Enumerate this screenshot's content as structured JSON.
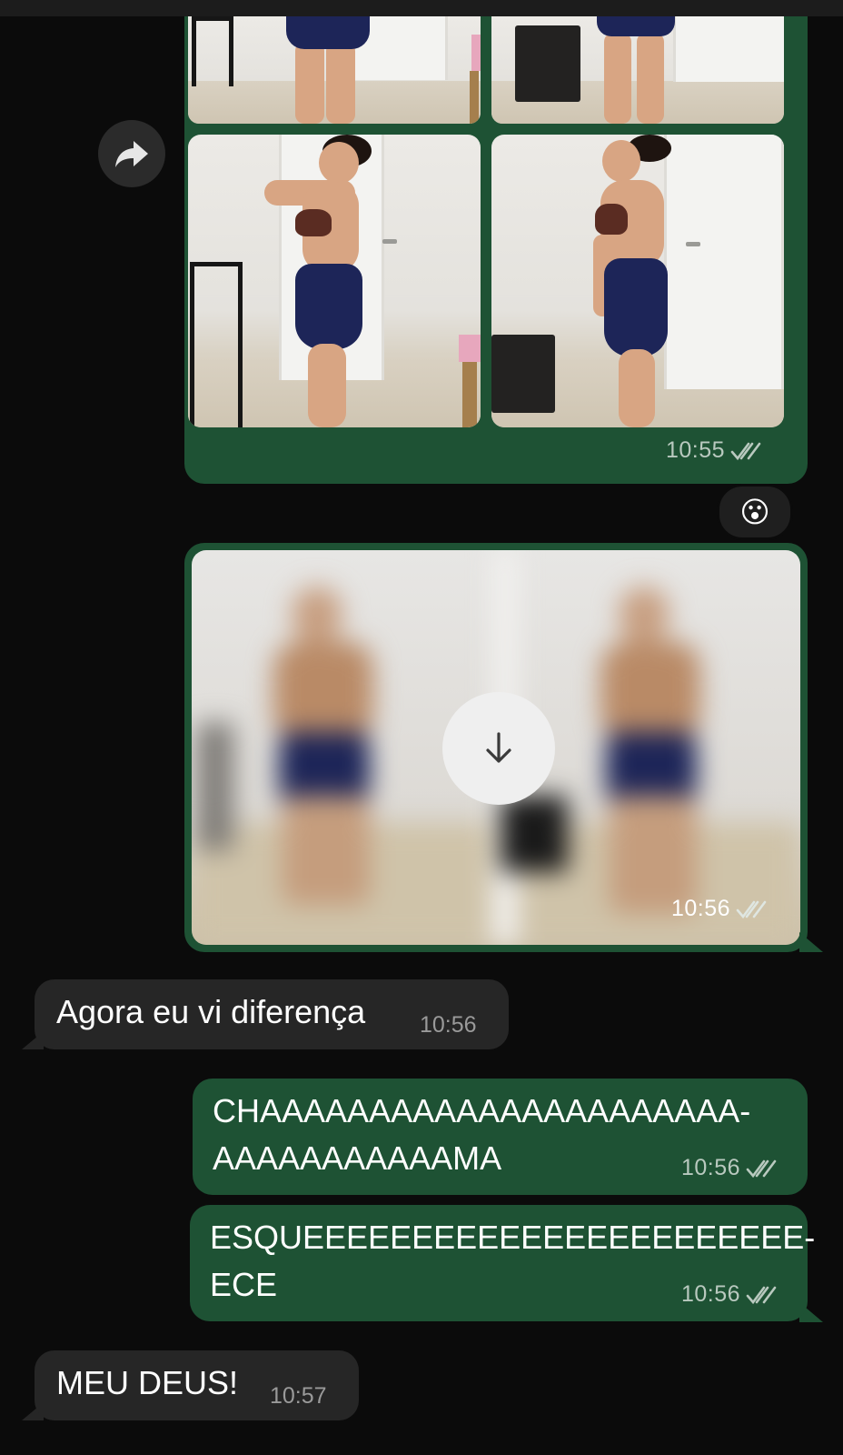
{
  "album": {
    "time": "10:55"
  },
  "reaction": {
    "emoji": "😮"
  },
  "video": {
    "time": "10:56"
  },
  "messages": [
    {
      "direction": "incoming",
      "text": "Agora eu vi diferença",
      "time": "10:56"
    },
    {
      "direction": "outgoing",
      "text": "CHAAAAAAAAAAAAAAAAAAAAAA-\nAAAAAAAAAAAMA",
      "time": "10:56"
    },
    {
      "direction": "outgoing",
      "text": "ESQUEEEEEEEEEEEEEEEEEEEEEEE-\nECE",
      "time": "10:56"
    },
    {
      "direction": "incoming",
      "text": "MEU DEUS!",
      "time": "10:57"
    }
  ],
  "icons": {
    "forward": "forward-arrow-icon",
    "download": "download-arrow-icon",
    "read_receipt": "double-check-icon"
  },
  "colors": {
    "outgoing_bubble": "#1e5234",
    "incoming_bubble": "#262626",
    "background": "#0b0b0b",
    "read_ticks": "#b9c9bf"
  }
}
